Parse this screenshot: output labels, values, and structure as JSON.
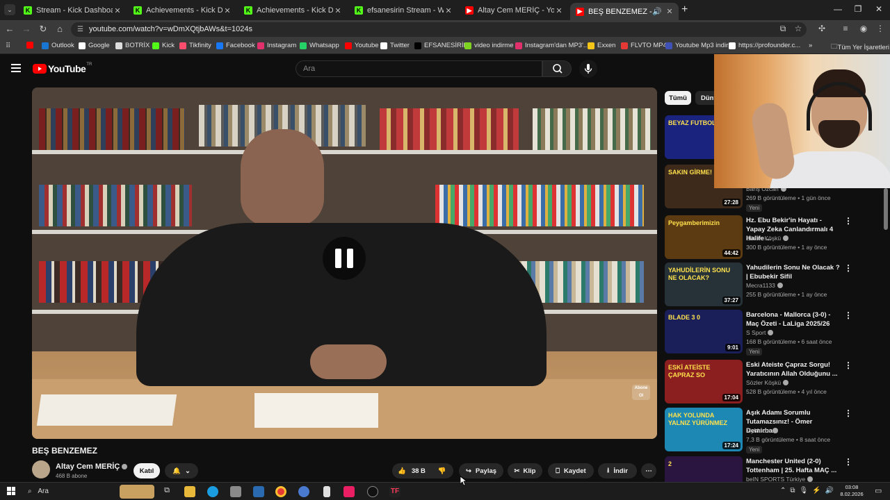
{
  "browser": {
    "tabs": [
      {
        "title": "Stream - Kick Dashboard",
        "icon": "kick-icon",
        "color": "#53fc18"
      },
      {
        "title": "Achievements - Kick Dashboard",
        "icon": "kick-icon",
        "color": "#53fc18"
      },
      {
        "title": "Achievements - Kick Dashboard",
        "icon": "kick-icon",
        "color": "#53fc18"
      },
      {
        "title": "efsanesirin Stream - Watch Live",
        "icon": "kick-icon",
        "color": "#53fc18"
      },
      {
        "title": "Altay Cem MERİÇ - YouTube",
        "icon": "youtube-icon",
        "color": "#ff0000"
      },
      {
        "title": "BEŞ BENZEMEZ - YouTube",
        "icon": "youtube-icon",
        "color": "#ff0000"
      }
    ],
    "url": "youtube.com/watch?v=wDmXQtjbAWs&t=1024s",
    "bookmarks": [
      {
        "label": "",
        "color": "#ff0000"
      },
      {
        "label": "Outlook",
        "color": "#1976d2"
      },
      {
        "label": "Google",
        "color": "#ffffff"
      },
      {
        "label": "BOTRİX",
        "color": "#dddddd"
      },
      {
        "label": "Kick",
        "color": "#53fc18"
      },
      {
        "label": "Tikfinity",
        "color": "#ff4d6d"
      },
      {
        "label": "Facebook",
        "color": "#1877f2"
      },
      {
        "label": "Instagram",
        "color": "#e1306c"
      },
      {
        "label": "Whatsapp",
        "color": "#25d366"
      },
      {
        "label": "Youtube",
        "color": "#ff0000"
      },
      {
        "label": "Twitter",
        "color": "#ffffff"
      },
      {
        "label": "EFSANESİRİN",
        "color": "#000000"
      },
      {
        "label": "video indirme",
        "color": "#7ed321"
      },
      {
        "label": "Instagram'dan MP3'...",
        "color": "#e1306c"
      },
      {
        "label": "Exxen",
        "color": "#f5c518"
      },
      {
        "label": "FLVTO MP4",
        "color": "#e53935"
      },
      {
        "label": "Youtube Mp3 indir",
        "color": "#3f51b5"
      },
      {
        "label": "https://profounder.c...",
        "color": "#ffffff"
      }
    ],
    "all_bookmarks": "Tüm Yer İşaretleri"
  },
  "youtube": {
    "logo_text": "YouTube",
    "logo_region": "TR",
    "search_placeholder": "Ara",
    "video_title": "BEŞ BENZEMEZ",
    "channel_name": "Altay Cem MERİÇ",
    "subscribers": "468 B abone",
    "join_label": "Katıl",
    "likes": "38 B",
    "share_label": "Paylaş",
    "clip_label": "Klip",
    "save_label": "Kaydet",
    "download_label": "İndir",
    "watermark": "Abone Ol",
    "chips": [
      "Tümü",
      "Dünya"
    ],
    "recommendations": [
      {
        "title": "",
        "channel": "",
        "meta": "",
        "duration": "",
        "thumb_text": "BEYAZ FUTBOL",
        "thumb_color": "#1a237e",
        "badge": ""
      },
      {
        "title": "",
        "channel": "Barış Özcan",
        "meta": "269 B görüntüleme • 1 gün önce",
        "duration": "27:28",
        "thumb_text": "SAKIN GİRME!",
        "thumb_color": "#3e2a1a",
        "badge": "Yeni"
      },
      {
        "title": "Hz. Ebu Bekir'in Hayatı - Yapay Zeka Canlandırmalı 4 Halife ...",
        "channel": "Sözler Köşkü",
        "meta": "300 B görüntüleme • 1 ay önce",
        "duration": "44:42",
        "thumb_text": "Peygamberimizin",
        "thumb_color": "#5d3b12",
        "badge": ""
      },
      {
        "title": "Yahudilerin Sonu Ne Olacak ? | Ebubekir Sifil",
        "channel": "Mecra1133",
        "meta": "255 B görüntüleme • 1 ay önce",
        "duration": "37:27",
        "thumb_text": "YAHUDİLERİN SONU NE OLACAK?",
        "thumb_color": "#263238",
        "badge": ""
      },
      {
        "title": "Barcelona - Mallorca (3-0) - Maç Özeti - LaLiga 2025/26",
        "channel": "S Sport",
        "meta": "168 B görüntüleme • 6 saat önce",
        "duration": "9:01",
        "thumb_text": "BLADE 3 0",
        "thumb_color": "#1a1f5a",
        "badge": "Yeni"
      },
      {
        "title": "Eski Ateiste Çapraz Sorgu! Yaratıcının Allah Olduğunu ...",
        "channel": "Sözler Köşkü",
        "meta": "528 B görüntüleme • 4 yıl önce",
        "duration": "17:04",
        "thumb_text": "ESKİ ATEİSTE ÇAPRAZ SO",
        "thumb_color": "#8b1e1e",
        "badge": ""
      },
      {
        "title": "Aşık Adamı Sorumlu Tutamazsınız! - Ömer Demirba...",
        "channel": "MyMecra",
        "meta": "7,3 B görüntüleme • 8 saat önce",
        "duration": "17:24",
        "thumb_text": "HAK YOLUNDA YALNIZ YÜRÜNMEZ",
        "thumb_color": "#1e88b5",
        "badge": "Yeni"
      },
      {
        "title": "Manchester United (2-0) Tottenham | 25. Hafta MAÇ ...",
        "channel": "beIN SPORTS Türkiye",
        "meta": "",
        "duration": "",
        "thumb_text": "2",
        "thumb_color": "#2a1540",
        "badge": ""
      }
    ]
  },
  "taskbar": {
    "search_label": "Ara",
    "time": "03:08",
    "date": "8.02.2026"
  }
}
